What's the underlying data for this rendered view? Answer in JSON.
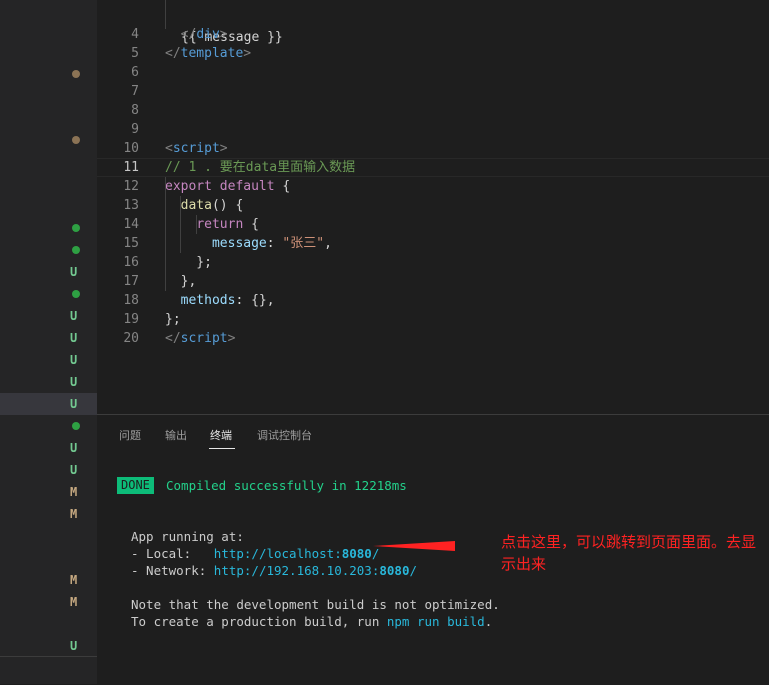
{
  "editor": {
    "lines": [
      {
        "n": "4",
        "segs": [
          [
            "t-punc",
            "  </"
          ],
          [
            "t-tag",
            "div"
          ],
          [
            "t-punc",
            ">"
          ]
        ]
      },
      {
        "n": "5",
        "segs": [
          [
            "t-punc",
            "</"
          ],
          [
            "t-tag",
            "template"
          ],
          [
            "t-punc",
            ">"
          ]
        ]
      },
      {
        "n": "6",
        "segs": []
      },
      {
        "n": "7",
        "segs": []
      },
      {
        "n": "8",
        "segs": []
      },
      {
        "n": "9",
        "segs": []
      },
      {
        "n": "10",
        "segs": [
          [
            "t-punc",
            "<"
          ],
          [
            "t-tag",
            "script"
          ],
          [
            "t-punc",
            ">"
          ]
        ]
      },
      {
        "n": "11",
        "segs": [
          [
            "t-comment",
            "// 1 . 要在data里面输入数据"
          ]
        ]
      },
      {
        "n": "12",
        "segs": [
          [
            "t-kw",
            "export"
          ],
          [
            "t-plain",
            " "
          ],
          [
            "t-kw",
            "default"
          ],
          [
            "t-plain",
            " {"
          ]
        ]
      },
      {
        "n": "13",
        "segs": [
          [
            "t-plain",
            "  "
          ],
          [
            "t-fn",
            "data"
          ],
          [
            "t-plain",
            "() {"
          ]
        ]
      },
      {
        "n": "14",
        "segs": [
          [
            "t-plain",
            "    "
          ],
          [
            "t-kw",
            "return"
          ],
          [
            "t-plain",
            " {"
          ]
        ]
      },
      {
        "n": "15",
        "segs": [
          [
            "t-plain",
            "      "
          ],
          [
            "t-prop",
            "message"
          ],
          [
            "t-plain",
            ": "
          ],
          [
            "t-str",
            "\"张三\""
          ],
          [
            "t-plain",
            ","
          ]
        ]
      },
      {
        "n": "16",
        "segs": [
          [
            "t-plain",
            "    };"
          ]
        ]
      },
      {
        "n": "17",
        "segs": [
          [
            "t-plain",
            "  },"
          ]
        ]
      },
      {
        "n": "18",
        "segs": [
          [
            "t-plain",
            "  "
          ],
          [
            "t-prop",
            "methods"
          ],
          [
            "t-plain",
            ": {},"
          ]
        ]
      },
      {
        "n": "19",
        "segs": [
          [
            "t-plain",
            "};"
          ]
        ]
      },
      {
        "n": "20",
        "segs": [
          [
            "t-punc",
            "</"
          ],
          [
            "t-tag",
            "script"
          ],
          [
            "t-punc",
            ">"
          ]
        ]
      }
    ],
    "partial_top": "{{ message }}"
  },
  "sidebar": {
    "markers": [
      {
        "type": "dot",
        "color": "#8b7355",
        "label": ""
      },
      {
        "type": "dot",
        "color": "#8b7355",
        "label": ""
      },
      {
        "type": "dot",
        "color": "#2ea043",
        "label": ""
      },
      {
        "type": "dot",
        "color": "#2ea043",
        "label": ""
      },
      {
        "type": "letter",
        "color": "#73c991",
        "label": "U"
      },
      {
        "type": "dot",
        "color": "#2ea043",
        "label": ""
      },
      {
        "type": "letter",
        "color": "#73c991",
        "label": "U"
      },
      {
        "type": "letter",
        "color": "#73c991",
        "label": "U"
      },
      {
        "type": "letter",
        "color": "#73c991",
        "label": "U"
      },
      {
        "type": "letter",
        "color": "#73c991",
        "label": "U"
      },
      {
        "type": "letter",
        "color": "#73c991",
        "label": "U"
      },
      {
        "type": "dot",
        "color": "#2ea043",
        "label": ""
      },
      {
        "type": "letter",
        "color": "#73c991",
        "label": "U"
      },
      {
        "type": "letter",
        "color": "#73c991",
        "label": "U"
      },
      {
        "type": "letter",
        "color": "#c5a880",
        "label": "M"
      },
      {
        "type": "letter",
        "color": "#c5a880",
        "label": "M"
      },
      {
        "type": "letter",
        "color": "#c5a880",
        "label": "M"
      },
      {
        "type": "letter",
        "color": "#c5a880",
        "label": "M"
      },
      {
        "type": "letter",
        "color": "#73c991",
        "label": "U"
      }
    ]
  },
  "panel": {
    "tabs": [
      "问题",
      "输出",
      "终端",
      "调试控制台"
    ],
    "active_tab": "终端",
    "done_label": "DONE",
    "compiled": "Compiled successfully in 12218ms",
    "app_running": "App running at:",
    "local_label": "- Local:   ",
    "local_url": "http://localhost:",
    "local_port": "8080",
    "local_slash": "/",
    "network_label": "- Network: ",
    "network_url": "http://192.168.10.203:",
    "network_port": "8080",
    "network_slash": "/",
    "note1": "Note that the development build is not optimized.",
    "note2_pre": "To create a production build, run ",
    "note2_cmd": "npm run build",
    "note2_post": ".",
    "annotation": "点击这里，可以跳转到页面里面。去显示出来"
  },
  "colors": {
    "accent_green": "#23d18b",
    "link_cyan": "#29b8db",
    "annotation_red": "#ff2222"
  }
}
